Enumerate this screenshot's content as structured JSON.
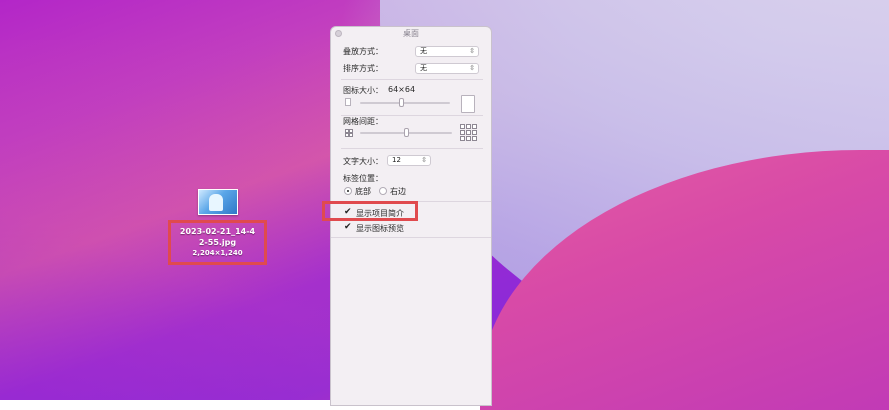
{
  "panel": {
    "title": "桌面",
    "stack_by": {
      "label": "叠放方式：",
      "value": "无"
    },
    "sort_by": {
      "label": "排序方式：",
      "value": "无"
    },
    "icon_size": {
      "label": "图标大小：",
      "value": "64×64",
      "slider_fraction": 0.45
    },
    "grid_spacing": {
      "label": "网格间距：",
      "slider_fraction": 0.5
    },
    "text_size": {
      "label": "文字大小：",
      "value": "12"
    },
    "label_position": {
      "label": "标签位置：",
      "options": [
        {
          "label": "底部",
          "selected": true
        },
        {
          "label": "右边",
          "selected": false
        }
      ]
    },
    "show_item_info": {
      "label": "显示项目简介",
      "checked": true
    },
    "show_icon_preview": {
      "label": "显示图标预览",
      "checked": true
    }
  },
  "desktop_item": {
    "name_line1": "2023-02-21_14-4",
    "name_line2": "2-55.jpg",
    "size": "2,204×1,240"
  },
  "colors": {
    "highlight": "#e04a4e"
  }
}
